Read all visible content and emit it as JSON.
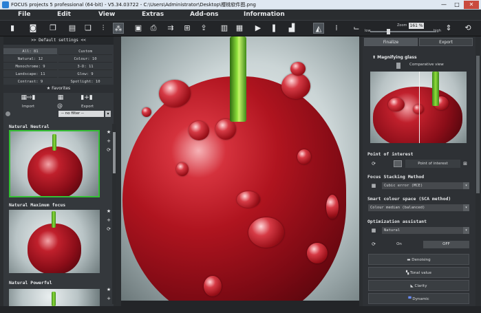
{
  "window": {
    "title": "FOCUS projects 5 professional (64-bit) - V5.34.03722 - C:\\Users\\Administrator\\Desktop\\樱桃软件图.png",
    "min": "—",
    "max": "□",
    "close": "✕"
  },
  "menu": [
    "File",
    "Edit",
    "View",
    "Extras",
    "Add-ons",
    "Information"
  ],
  "toolbar": {
    "zoom_label": "Zoom",
    "zoom_value": "161 %",
    "low_label": "low",
    "high_label": "high"
  },
  "left_panel": {
    "header": ">> Default settings <<",
    "counts": [
      [
        "All: 81",
        "Custom"
      ],
      [
        "Natural: 12",
        "Colour: 10"
      ],
      [
        "Monochrome: 9",
        "3-D: 11"
      ],
      [
        "Landscape: 11",
        "Glow: 9"
      ],
      [
        "Contrast: 9",
        "Spotlight: 10"
      ]
    ],
    "favorites": "★ Favorites",
    "import_label": "Import",
    "export_label": "Export",
    "at_symbol": "@",
    "filter_value": "-- no filter --",
    "presets": [
      "Natural Neutral",
      "Natural Maximum focus",
      "Natural Powerful"
    ]
  },
  "right_panel": {
    "tab_finalize": "Finalize",
    "tab_export": "Export",
    "magnifying_glass": "Magnifying glass",
    "comparative_view": "Comparative view",
    "poi_title": "Point of interest",
    "poi_button": "Point of interest",
    "stacking_title": "Focus Stacking Method",
    "stacking_value": "Cubic error (MCE)",
    "colour_space_title": "Smart colour space (SCA method)",
    "colour_space_value": "Colour median (balanced)",
    "optimization_title": "Optimization assistant",
    "optimization_value": "Natural",
    "on_label": "On",
    "off_label": "OFF",
    "buttons": [
      "Denoising",
      "Tonal value",
      "Clarity",
      "Dynamic"
    ]
  },
  "accent": "#34c134"
}
